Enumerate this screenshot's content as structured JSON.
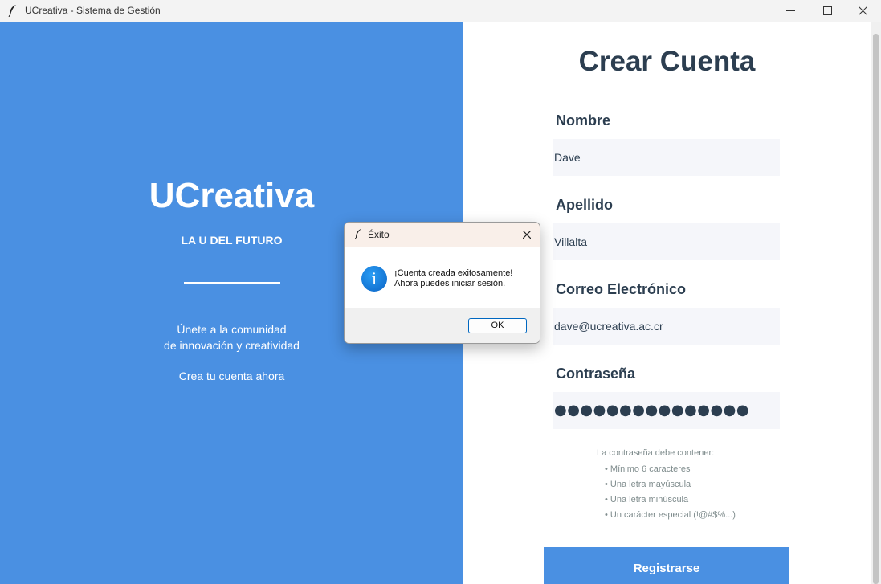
{
  "window": {
    "title": "UCreativa - Sistema de Gestión",
    "icon": "feather-icon",
    "controls": [
      "minimize-icon",
      "maximize-icon",
      "close-icon"
    ]
  },
  "left_panel": {
    "brand": "UCreativa",
    "tagline": "LA U DEL FUTURO",
    "welcome_line1": "Únete a la comunidad",
    "welcome_line2": "de innovación y creatividad",
    "cta": "Crea tu cuenta ahora",
    "background_color": "#4a90e2"
  },
  "form": {
    "heading": "Crear Cuenta",
    "first_name": {
      "label": "Nombre",
      "value": "Dave"
    },
    "last_name": {
      "label": "Apellido",
      "value": "Villalta"
    },
    "email": {
      "label": "Correo Electrónico",
      "value": "dave@ucreativa.ac.cr"
    },
    "password": {
      "label": "Contraseña",
      "masked_value": "●●●●●●●●●●●●●●●"
    },
    "password_hint": {
      "title": "La contraseña debe contener:",
      "items": [
        "• Mínimo 6 caracteres",
        "• Una letra mayúscula",
        "• Una letra minúscula",
        "• Un carácter especial (!@#$%...)"
      ]
    },
    "register_label": "Registrarse"
  },
  "dialog": {
    "title": "Éxito",
    "icon": "info-icon",
    "message_line1": "¡Cuenta creada exitosamente!",
    "message_line2": "Ahora puedes iniciar sesión.",
    "ok_label": "OK"
  },
  "colors": {
    "accent": "#4a90e2",
    "heading": "#2c3e50",
    "field_bg": "#f5f6fa",
    "hint": "#7f8c8d"
  }
}
